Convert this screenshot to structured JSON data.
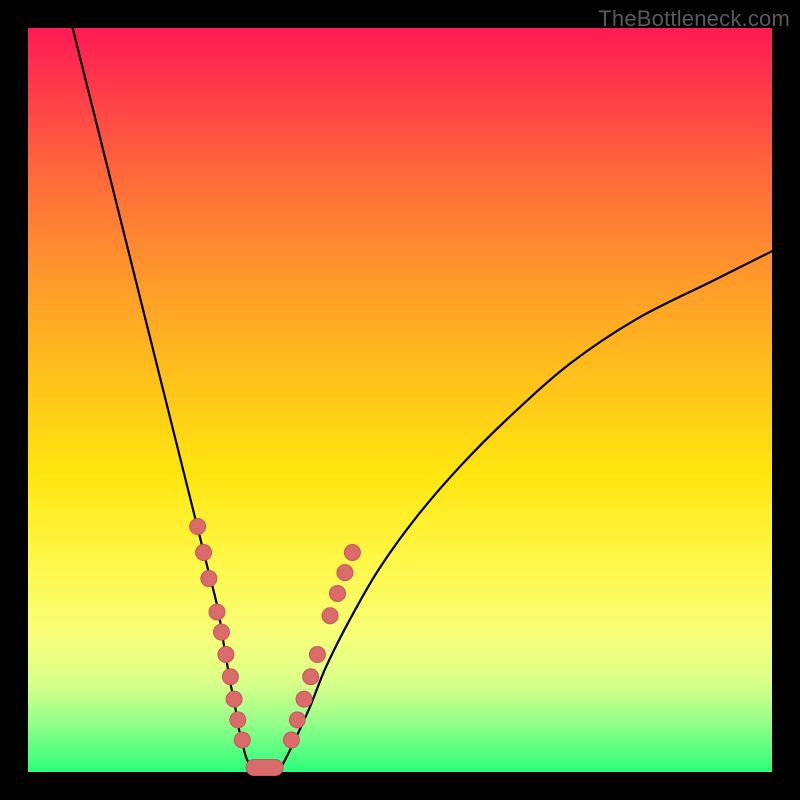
{
  "watermark": "TheBottleneck.com",
  "colors": {
    "dot": "#db6b6b",
    "dot_stroke": "#c25a5a",
    "curve": "#000000"
  },
  "chart_data": {
    "type": "line",
    "title": "",
    "xlabel": "",
    "ylabel": "",
    "x_range": [
      0,
      100
    ],
    "y_range": [
      0,
      100
    ],
    "note": "V-shaped bottleneck curve with overlaid sample dots; axes are unlabeled so values are relative estimates on a 0–100 grid.",
    "series": [
      {
        "name": "curve_left",
        "x": [
          6,
          9,
          12,
          15,
          18,
          20,
          22,
          24,
          25.5,
          26.5,
          27.2,
          27.8,
          28.3,
          28.8,
          29.3,
          30.0
        ],
        "y": [
          100,
          88,
          76,
          64,
          52,
          44,
          36,
          28,
          22,
          16,
          12,
          9,
          6,
          4,
          2,
          0.6
        ]
      },
      {
        "name": "curve_right",
        "x": [
          34.0,
          35.0,
          36.2,
          38,
          40,
          43,
          47,
          52,
          58,
          65,
          73,
          82,
          92,
          100
        ],
        "y": [
          0.6,
          2.5,
          5,
          9,
          14,
          20,
          27,
          34,
          41,
          48,
          55,
          61,
          66,
          70
        ]
      },
      {
        "name": "bottom_segment",
        "x": [
          30.0,
          34.0
        ],
        "y": [
          0.6,
          0.6
        ]
      }
    ],
    "dots": {
      "left": [
        {
          "x": 22.8,
          "y": 33.0
        },
        {
          "x": 23.6,
          "y": 29.5
        },
        {
          "x": 24.3,
          "y": 26.0
        },
        {
          "x": 25.4,
          "y": 21.5
        },
        {
          "x": 26.0,
          "y": 18.8
        },
        {
          "x": 26.6,
          "y": 15.8
        },
        {
          "x": 27.2,
          "y": 12.8
        },
        {
          "x": 27.7,
          "y": 9.8
        },
        {
          "x": 28.2,
          "y": 7.0
        },
        {
          "x": 28.8,
          "y": 4.3
        }
      ],
      "right": [
        {
          "x": 35.4,
          "y": 4.3
        },
        {
          "x": 36.2,
          "y": 7.0
        },
        {
          "x": 37.1,
          "y": 9.8
        },
        {
          "x": 38.0,
          "y": 12.8
        },
        {
          "x": 38.9,
          "y": 15.8
        },
        {
          "x": 40.6,
          "y": 21.0
        },
        {
          "x": 41.6,
          "y": 24.0
        },
        {
          "x": 42.6,
          "y": 26.8
        },
        {
          "x": 43.6,
          "y": 29.5
        }
      ]
    },
    "bottom_pill": {
      "x": 29.3,
      "w": 5.0,
      "y": 0.6
    }
  }
}
